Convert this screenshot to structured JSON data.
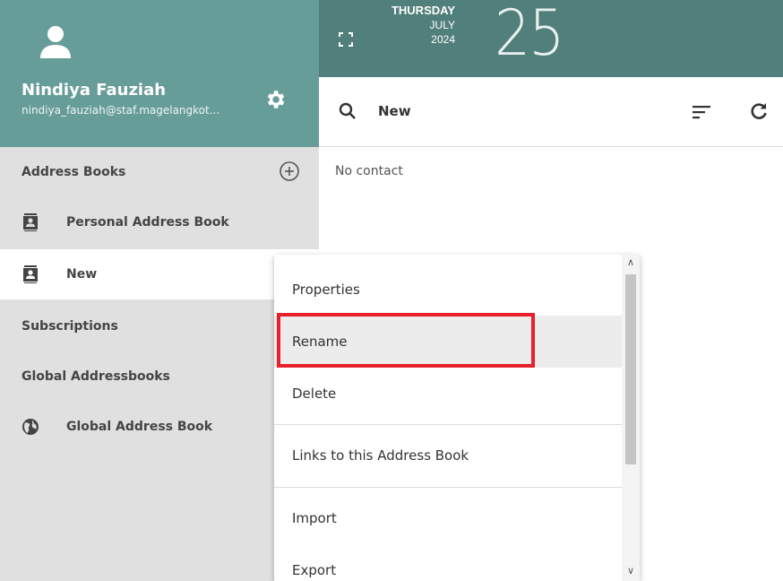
{
  "user": {
    "name": "Nindiya Fauziah",
    "email": "nindiya_fauziah@staf.magelangkot..."
  },
  "date": {
    "day_name": "THURSDAY",
    "month": "JULY",
    "year": "2024",
    "day": "25"
  },
  "sidebar": {
    "address_books_header": "Address Books",
    "address_books": [
      {
        "label": "Personal Address Book",
        "icon": "contact-book-icon"
      },
      {
        "label": "New",
        "icon": "contact-book-icon",
        "selected": true
      }
    ],
    "subscriptions_header": "Subscriptions",
    "global_header": "Global Addressbooks",
    "global_books": [
      {
        "label": "Global Address Book",
        "icon": "globe-icon"
      }
    ]
  },
  "toolbar": {
    "title": "New"
  },
  "content": {
    "empty_text": "No contact"
  },
  "context_menu": {
    "items": [
      {
        "label": "Properties"
      },
      {
        "label": "Rename",
        "highlighted": true
      },
      {
        "label": "Delete"
      },
      {
        "label": "Links to this Address Book"
      },
      {
        "label": "Import"
      },
      {
        "label": "Export"
      }
    ]
  },
  "colors": {
    "header_teal": "#679d98",
    "topbar_teal": "#517f7b",
    "sidebar_bg": "#e0e0e0",
    "highlight_red": "#e8202a"
  }
}
